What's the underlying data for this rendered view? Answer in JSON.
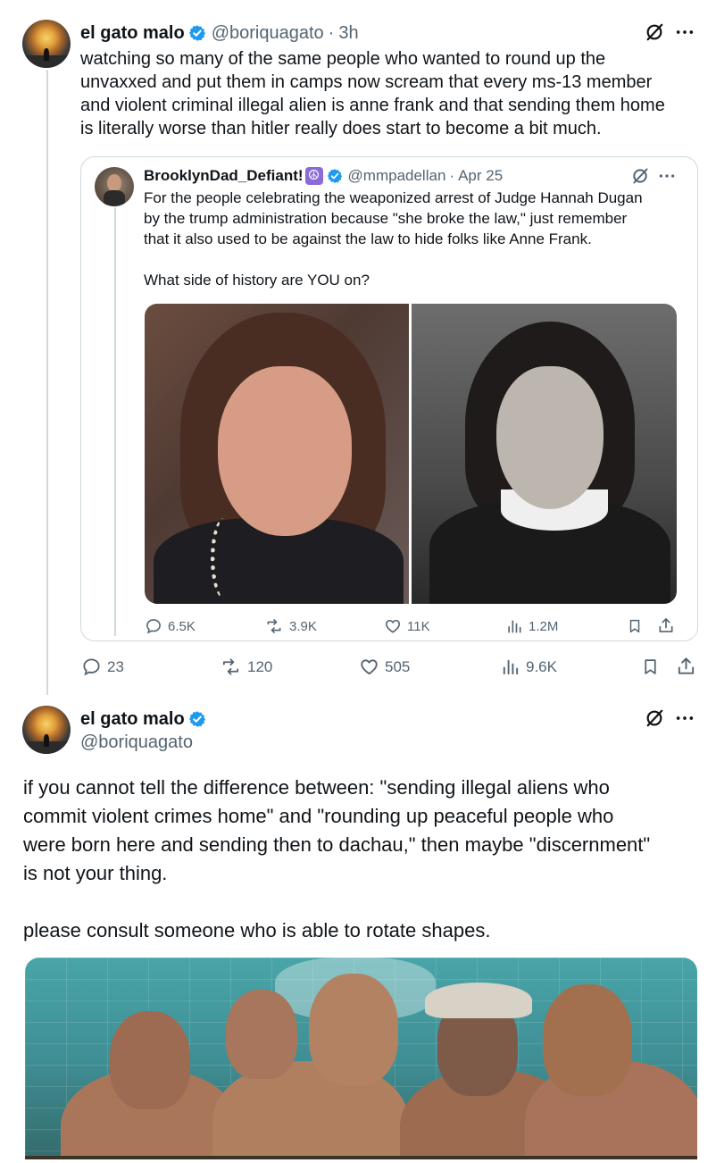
{
  "tweet1": {
    "display_name": "el gato malo",
    "handle": "@boriquagato",
    "dot": "·",
    "time": "3h",
    "text_lines": [
      "watching so many of the same people who wanted to round up the",
      "unvaxxed and put them in camps now scream that every ms-13 member",
      "and violent criminal illegal alien is anne frank and that sending them home",
      "is literally worse than hitler really does start to become a bit much."
    ],
    "actions": {
      "replies": "23",
      "reposts": "120",
      "likes": "505",
      "views": "9.6K"
    }
  },
  "quote": {
    "display_name": "BrooklynDad_Defiant!",
    "peace_emoji": "☮",
    "handle": "@mmpadellan",
    "dot": "·",
    "date": "Apr 25",
    "text_lines": [
      "For the people celebrating the weaponized arrest of Judge Hannah Dugan",
      "by the trump administration because \"she broke the law,\" just remember",
      "that it also used to be against the law to hide folks like Anne Frank."
    ],
    "question": "What side of history are YOU on?",
    "actions": {
      "replies": "6.5K",
      "reposts": "3.9K",
      "likes": "11K",
      "views": "1.2M"
    }
  },
  "tweet2": {
    "display_name": "el gato malo",
    "handle": "@boriquagato",
    "text_lines": [
      "if you cannot tell the difference between:  \"sending illegal aliens who",
      "commit violent crimes home\" and \"rounding up peaceful people who",
      "were born here and sending then to dachau,\" then maybe \"discernment\"",
      "is not your thing."
    ],
    "text_line_2": "please consult someone who is able to rotate shapes."
  },
  "icons": {
    "more": "more-horizontal-icon",
    "grok": "grok-icon",
    "verified": "verified-badge-icon",
    "reply": "reply-icon",
    "repost": "repost-icon",
    "like": "like-icon",
    "views": "views-icon",
    "bookmark": "bookmark-icon",
    "share": "share-icon"
  },
  "colors": {
    "verified": "#1d9bf0",
    "secondary_text": "#536471",
    "border": "#cfd9de",
    "peace_badge": "#8b6bd6"
  }
}
